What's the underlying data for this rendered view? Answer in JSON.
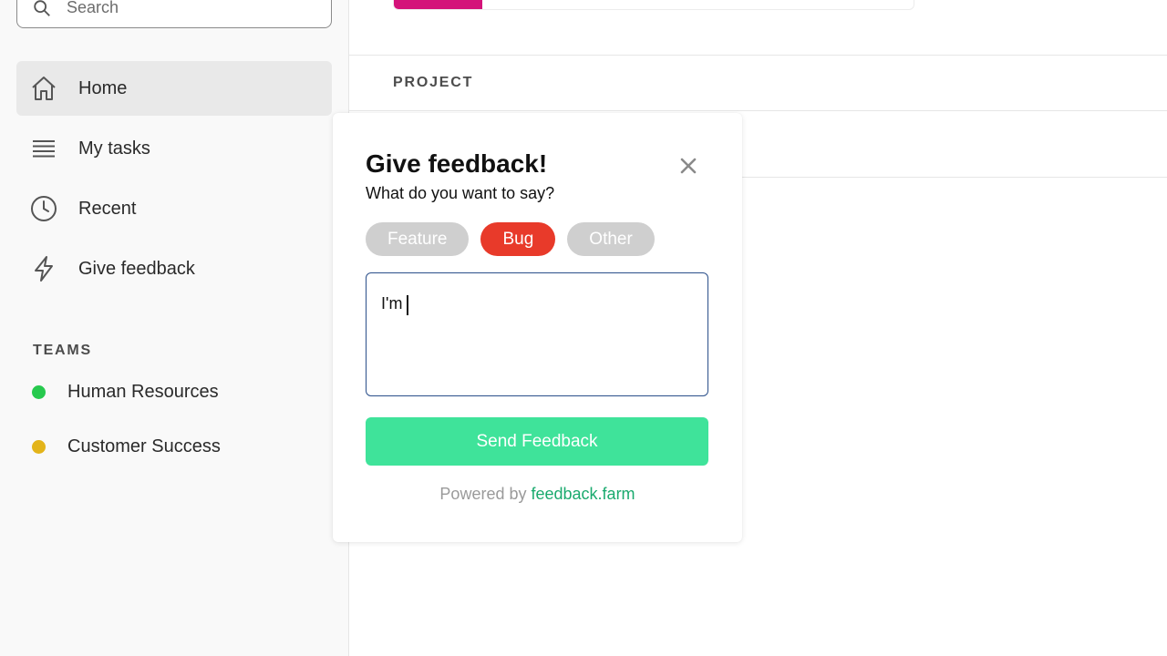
{
  "search": {
    "placeholder": "Search"
  },
  "sidebar": {
    "items": [
      {
        "label": "Home",
        "icon": "home-icon",
        "active": true
      },
      {
        "label": "My tasks",
        "icon": "list-icon",
        "active": false
      },
      {
        "label": "Recent",
        "icon": "clock-icon",
        "active": false
      },
      {
        "label": "Give feedback",
        "icon": "lightning-icon",
        "active": false
      }
    ],
    "teams_header": "TEAMS",
    "teams": [
      {
        "label": "Human Resources",
        "color": "#27c94e"
      },
      {
        "label": "Customer Success",
        "color": "#e3b41a"
      }
    ]
  },
  "main": {
    "progress_fraction": 0.17,
    "progress_color": "#d4137a",
    "project_header": "PROJECT"
  },
  "feedback_modal": {
    "title": "Give feedback!",
    "subtitle": "What do you want to say?",
    "close_icon": "close-icon",
    "categories": [
      {
        "label": "Feature",
        "selected": false
      },
      {
        "label": "Bug",
        "selected": true
      },
      {
        "label": "Other",
        "selected": false
      }
    ],
    "message_value": "I'm",
    "send_label": "Send Feedback",
    "powered_prefix": "Powered by",
    "powered_link": "feedback.farm",
    "colors": {
      "selected_chip": "#e83a2a",
      "chip": "#cfcfcf",
      "send_button": "#3fe39a",
      "link": "#1aaa6e"
    }
  }
}
